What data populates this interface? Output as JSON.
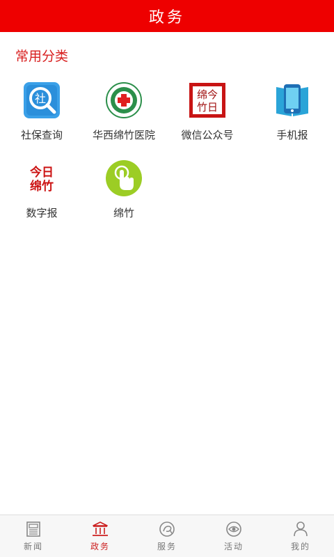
{
  "header": {
    "title": "政务"
  },
  "section": {
    "title": "常用分类"
  },
  "shortcuts": [
    {
      "label": "社保查询",
      "icon": "social-security-icon",
      "icon_text": "社"
    },
    {
      "label": "华西绵竹医院",
      "icon": "hospital-logo-icon"
    },
    {
      "label": "微信公众号",
      "icon": "wechat-official-account-icon",
      "icon_text_a": "绵今",
      "icon_text_b": "竹日"
    },
    {
      "label": "手机报",
      "icon": "mobile-newspaper-icon"
    },
    {
      "label": "数字报",
      "icon": "digital-newspaper-icon",
      "icon_text_a": "今日",
      "icon_text_b": "绵竹"
    },
    {
      "label": "绵竹",
      "icon": "touch-hand-icon"
    }
  ],
  "tabs": [
    {
      "label": "新闻",
      "icon": "newspaper-icon",
      "active": false
    },
    {
      "label": "政务",
      "icon": "government-building-icon",
      "active": true
    },
    {
      "label": "服务",
      "icon": "service-icon",
      "active": false
    },
    {
      "label": "活动",
      "icon": "eye-icon",
      "active": false
    },
    {
      "label": "我的",
      "icon": "user-icon",
      "active": false
    }
  ],
  "colors": {
    "header_bg": "#ee0000",
    "accent": "#d81e1e",
    "tab_active": "#cc1f1f",
    "tab_inactive": "#777777"
  }
}
